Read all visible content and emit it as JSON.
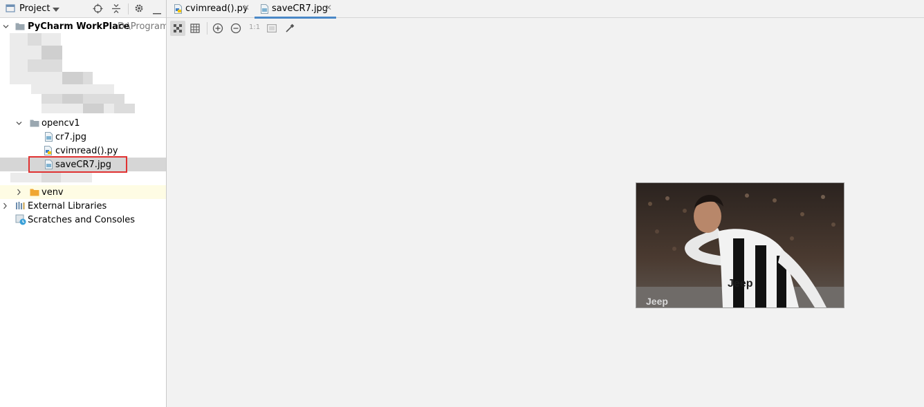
{
  "project_panel": {
    "title": "Project",
    "root": {
      "name": "PyCharm WorkPlace",
      "path": "D:\\Program\\"
    },
    "folder": {
      "name": "opencv1",
      "files": [
        {
          "name": "cr7.jpg",
          "kind": "image"
        },
        {
          "name": "cvimread().py",
          "kind": "python"
        },
        {
          "name": "saveCR7.jpg",
          "kind": "image",
          "selected": true
        }
      ]
    },
    "venv": "venv",
    "external_libraries": "External Libraries",
    "scratches": "Scratches and Consoles"
  },
  "editor": {
    "tabs": [
      {
        "label": "cvimread().py",
        "kind": "python",
        "active": false
      },
      {
        "label": "saveCR7.jpg",
        "kind": "image",
        "active": true
      }
    ],
    "toolbar": {
      "one_to_one": "1:1"
    }
  },
  "colors": {
    "selection": "#d6d6d6",
    "highlight": "#e03131",
    "active_tab": "#4a88c7",
    "folder": "#9aa7b0",
    "venv_folder": "#f0a732"
  }
}
